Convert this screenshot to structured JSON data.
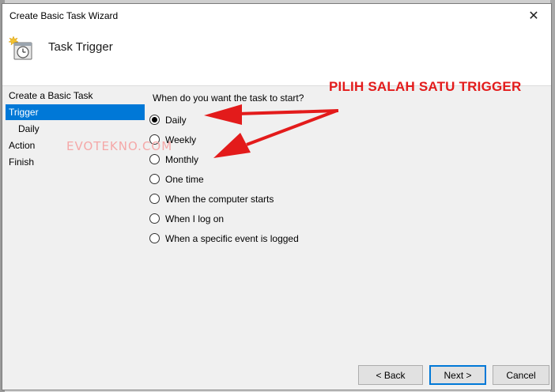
{
  "window": {
    "title": "Create Basic Task Wizard",
    "close_glyph": "✕"
  },
  "header": {
    "title": "Task Trigger",
    "icon": "task-clock-icon"
  },
  "nav": {
    "items": [
      {
        "label": "Create a Basic Task",
        "selected": false
      },
      {
        "label": "Trigger",
        "selected": true
      },
      {
        "label": "Daily",
        "selected": false
      },
      {
        "label": "Action",
        "selected": false
      },
      {
        "label": "Finish",
        "selected": false
      }
    ]
  },
  "main": {
    "question": "When do you want the task to start?",
    "options": [
      {
        "label": "Daily",
        "checked": true
      },
      {
        "label": "Weekly",
        "checked": false
      },
      {
        "label": "Monthly",
        "checked": false
      },
      {
        "label": "One time",
        "checked": false
      },
      {
        "label": "When the computer starts",
        "checked": false
      },
      {
        "label": "When I log on",
        "checked": false
      },
      {
        "label": "When a specific event is logged",
        "checked": false
      }
    ]
  },
  "overlay": {
    "annotation": "PILIH SALAH SATU TRIGGER",
    "watermark": "EVOTEKNO.COM",
    "accent_color": "#e31b1b"
  },
  "buttons": {
    "back": "< Back",
    "next": "Next >",
    "cancel": "Cancel"
  },
  "colors": {
    "selection": "#0078d7",
    "dialog_bg": "#f0f0f0"
  }
}
